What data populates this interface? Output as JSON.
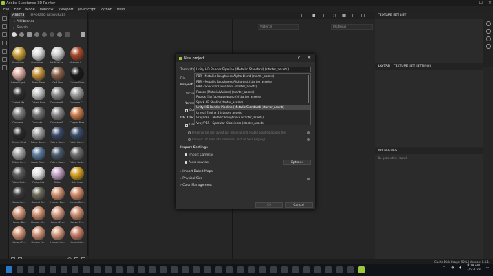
{
  "window": {
    "title": "Adobe Substance 3D Painter"
  },
  "menu": [
    "File",
    "Edit",
    "Mode",
    "Window",
    "Viewport",
    "JavaScript",
    "Python",
    "Help"
  ],
  "assets": {
    "tabs": [
      "ASSETS",
      "IMPORTED RESOURCES"
    ],
    "library": "All libraries",
    "search_placeholder": "Search",
    "items": [
      {
        "label": "Aluminium...",
        "color": "#c9a038"
      },
      {
        "label": "Aluminium...",
        "color": "#d8d8d8"
      },
      {
        "label": "Artificial Le...",
        "color": "#cccccc"
      },
      {
        "label": "Autumn L...",
        "color": "#a84a2a"
      },
      {
        "label": "Baked Light...",
        "color": "#d9a9a0"
      },
      {
        "label": "Basic Plate",
        "color": "#c4903a"
      },
      {
        "label": "Calf Skin",
        "color": "#8a6248"
      },
      {
        "label": "Carbon Fiber",
        "color": "#1a1a1a"
      },
      {
        "label": "Coated Me...",
        "color": "#2e2e2e"
      },
      {
        "label": "Cobalt Pure",
        "color": "#bfbfbf"
      },
      {
        "label": "Concrete B...",
        "color": "#8a8a8a"
      },
      {
        "label": "Concrete C...",
        "color": "#9a9a9a"
      },
      {
        "label": "Concrete ...",
        "color": "#7a7a7a"
      },
      {
        "label": "Concrete ...",
        "color": "#707070"
      },
      {
        "label": "Concrete S...",
        "color": "#858585"
      },
      {
        "label": "Copper Pure",
        "color": "#c87a4a"
      },
      {
        "label": "Denim Rivet",
        "color": "#2a2a2a"
      },
      {
        "label": "Fabric Bam...",
        "color": "#9a9a9a"
      },
      {
        "label": "Fabric Bas...",
        "color": "#3a4a6a"
      },
      {
        "label": "Fabric Den...",
        "color": "#3a4d6a"
      },
      {
        "label": "Fabric Kni...",
        "color": "#a0a0a0"
      },
      {
        "label": "Fabric Rou...",
        "color": "#5a7a9a"
      },
      {
        "label": "Fabric Rou...",
        "color": "#4a5a6a"
      },
      {
        "label": "Fabric Soft...",
        "color": "#6a6a6a"
      },
      {
        "label": "Fabric Suit...",
        "color": "#5a5a5a"
      },
      {
        "label": "Footprints",
        "color": "#e0e0e0"
      },
      {
        "label": "Glitter",
        "color": "#c0a0c0"
      },
      {
        "label": "Gold Pure",
        "color": "#d4a020"
      },
      {
        "label": "Gouache ...",
        "color": "#3a3a3a"
      },
      {
        "label": "Ground Gr...",
        "color": "#6a6a5a"
      },
      {
        "label": "Human Ba...",
        "color": "#d09070"
      },
      {
        "label": "Human Bel...",
        "color": "#d08a6a"
      },
      {
        "label": "Human Bo...",
        "color": "#d0957a"
      },
      {
        "label": "Human Ch...",
        "color": "#d09070"
      },
      {
        "label": "Human Eye...",
        "color": "#d59a80"
      },
      {
        "label": "Human Fe...",
        "color": "#cf8f72"
      },
      {
        "label": "Human Fe...",
        "color": "#d49478"
      },
      {
        "label": "Human Fo...",
        "color": "#d09276"
      },
      {
        "label": "Human He...",
        "color": "#d59a7c"
      },
      {
        "label": "Human Lip...",
        "color": "#c8806a"
      }
    ]
  },
  "viewport": {
    "material_left": "Material",
    "material_right": "Material"
  },
  "right": {
    "texture_set_list": "TEXTURE SET LIST",
    "layers_tab": "LAYERS",
    "texture_set_settings_tab": "TEXTURE SET SETTINGS",
    "properties": "PROPERTIES",
    "no_properties": "No properties found"
  },
  "dialog": {
    "title": "New project",
    "template_label": "Template",
    "template_value": "Unity HD Render Pipeline (Metallic Standard) (starter_assets)",
    "options": [
      "PBR - Metallic Roughness Alpha-blend (starter_assets)",
      "PBR - Metallic Roughness Alpha-test (starter_assets)",
      "PBR - Specular Glossiness (starter_assets)",
      "Roblox (MaterialVariant) (starter_assets)",
      "Roblox (SurfaceAppearance) (starter_assets)",
      "Spark AR Studio (starter_assets)",
      "Unity HD Render Pipeline (Metallic Standard) (starter_assets)",
      "Unreal Engine 4 (starter_assets)",
      "Vray/PBR - Metallic Roughness (starter_assets)",
      "Vray/PBR - Specular Glossiness (starter_assets)"
    ],
    "selected_index": 6,
    "file_label": "File",
    "project_label": "Project S",
    "document_label": "Docum",
    "normal_label": "Normal",
    "compute_label": "Com",
    "uv_label": "UV Tile S",
    "use_uv_label": "Use UV Tile workflow",
    "preserve_label": "Preserve UV Tile layout per material and enable painting across tiles",
    "convert_label": "Convert UV Tiles into individual Texture Sets (legacy)",
    "import_settings": "Import Settings",
    "import_cameras": "Import Cameras",
    "auto_unwrap": "Auto-unwrap",
    "options_button": "Options",
    "import_baked_maps": "Import Baked Maps",
    "physical_size": "Physical Size",
    "color_management": "Color Management",
    "ok": "OK",
    "cancel": "Cancel"
  },
  "status": {
    "cache": "Cache Disk Usage:  92% | Version: 8.3.1"
  },
  "tray": {
    "time": "9:19 AM",
    "date": "7/6/2023"
  }
}
